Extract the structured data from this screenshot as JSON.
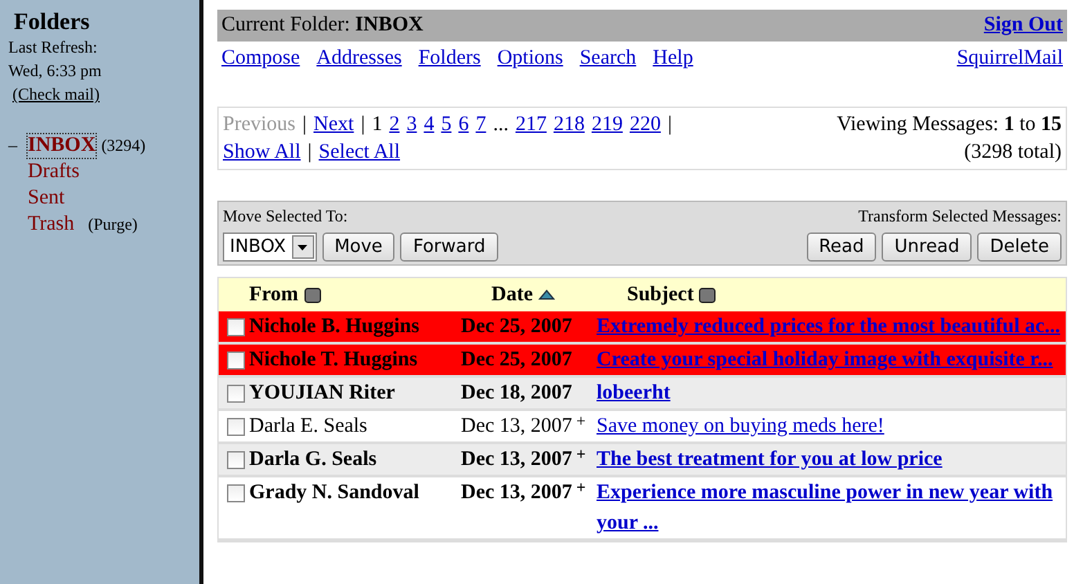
{
  "sidebar": {
    "title": "Folders",
    "refresh_label": "Last Refresh:",
    "refresh_time": "Wed, 6:33 pm",
    "check_mail": "(Check mail)",
    "folders": [
      {
        "name": "INBOX",
        "count": "(3294)",
        "selected": true,
        "toggle": "–"
      },
      {
        "name": "Drafts",
        "selected": false
      },
      {
        "name": "Sent",
        "selected": false
      },
      {
        "name": "Trash",
        "selected": false,
        "action": "(Purge)"
      }
    ]
  },
  "header": {
    "label": "Current Folder:",
    "folder": "INBOX",
    "sign_out": "Sign Out"
  },
  "nav": {
    "links": [
      "Compose",
      "Addresses",
      "Folders",
      "Options",
      "Search",
      "Help"
    ],
    "brand": "SquirrelMail"
  },
  "pagination": {
    "items": [
      {
        "label": "Previous",
        "kind": "disabled"
      },
      {
        "label": "|",
        "kind": "sep"
      },
      {
        "label": "Next",
        "kind": "link"
      },
      {
        "label": "|",
        "kind": "sep"
      },
      {
        "label": "1",
        "kind": "current"
      },
      {
        "label": "2",
        "kind": "link"
      },
      {
        "label": "3",
        "kind": "link"
      },
      {
        "label": "4",
        "kind": "link"
      },
      {
        "label": "5",
        "kind": "link"
      },
      {
        "label": "6",
        "kind": "link"
      },
      {
        "label": "7",
        "kind": "link"
      },
      {
        "label": "...",
        "kind": "sep"
      },
      {
        "label": "217",
        "kind": "link"
      },
      {
        "label": "218",
        "kind": "link"
      },
      {
        "label": "219",
        "kind": "link"
      },
      {
        "label": "220",
        "kind": "link"
      },
      {
        "label": "|",
        "kind": "sep"
      },
      {
        "label": "Show All",
        "kind": "link"
      },
      {
        "label": "|",
        "kind": "sep"
      },
      {
        "label": "Select All",
        "kind": "link"
      }
    ],
    "viewing": "Viewing Messages: **1** to **15**",
    "total": "(3298 total)"
  },
  "actions": {
    "move_label": "Move Selected To:",
    "folder_select": "INBOX",
    "move_buttons": [
      "Move",
      "Forward"
    ],
    "transform_label": "Transform Selected Messages:",
    "transform_buttons": [
      "Read",
      "Unread",
      "Delete"
    ]
  },
  "table": {
    "columns": [
      {
        "label": "From",
        "sorted": false
      },
      {
        "label": "Date",
        "sorted": true
      },
      {
        "label": "Subject",
        "sorted": false
      }
    ],
    "rows": [
      {
        "from": "Nichole B. Huggins",
        "date": "Dec 25, 2007",
        "subject": "Extremely reduced prices for the most beautiful ac...",
        "unread": true,
        "flagged": true,
        "checked": false
      },
      {
        "from": "Nichole T. Huggins",
        "date": "Dec 25, 2007",
        "subject": "Create your special holiday image with exquisite r...",
        "unread": true,
        "flagged": true,
        "checked": false
      },
      {
        "from": "YOUJIAN Riter",
        "date": "Dec 18, 2007",
        "subject": "lobeerht",
        "unread": true,
        "flagged": false,
        "checked": false
      },
      {
        "from": "Darla E. Seals",
        "date": "Dec 13, 2007",
        "attachment": "+",
        "subject": "Save money on buying meds here!",
        "unread": false,
        "flagged": false,
        "checked": false
      },
      {
        "from": "Darla G. Seals",
        "date": "Dec 13, 2007",
        "attachment": "+",
        "subject": "The best treatment for you at low price",
        "unread": true,
        "flagged": false,
        "checked": false
      },
      {
        "from": "Grady N. Sandoval",
        "date": "Dec 13, 2007",
        "attachment": "+",
        "subject": "Experience more masculine power in new year with your ...",
        "unread": true,
        "flagged": false,
        "checked": false
      }
    ]
  }
}
